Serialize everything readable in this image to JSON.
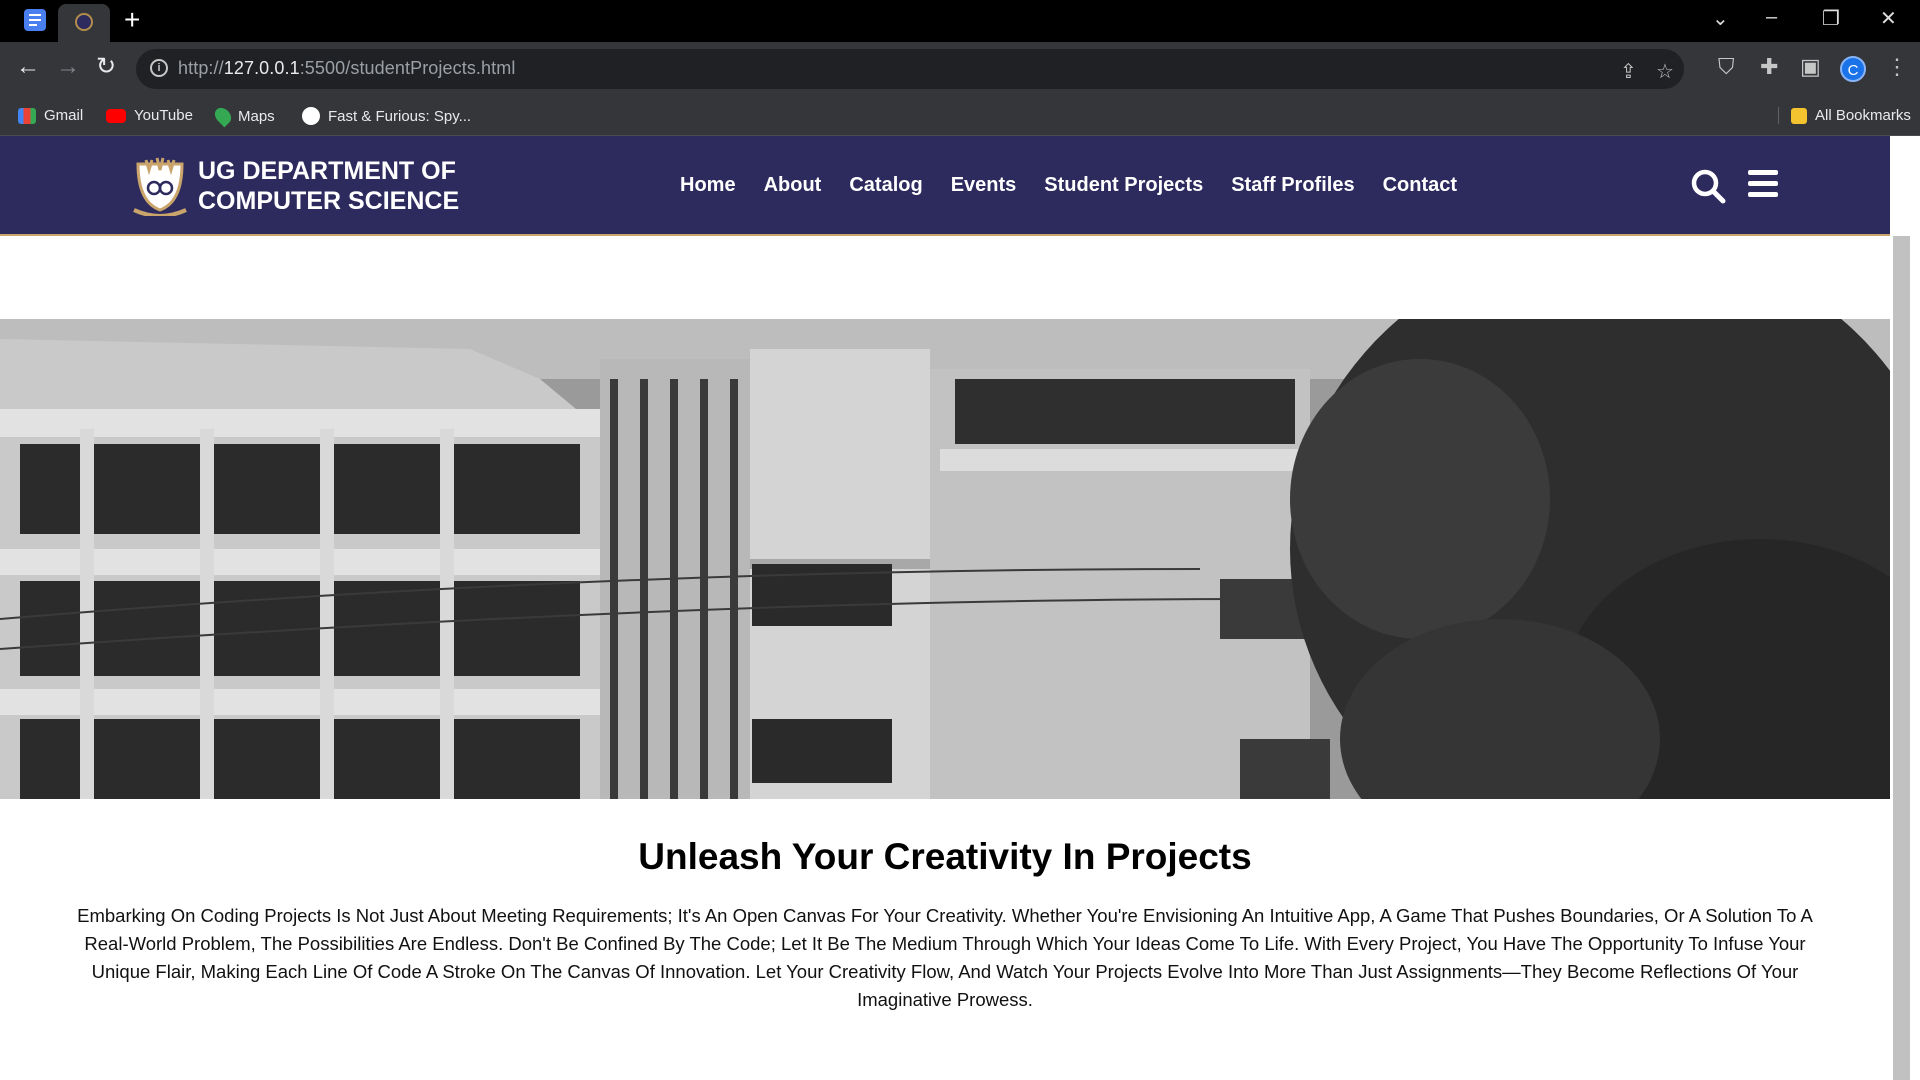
{
  "browser": {
    "url_prefix": "http://",
    "url_host": "127.0.0.1",
    "url_rest": ":5500/studentProjects.html",
    "new_tab_symbol": "+",
    "profile_initial": "C",
    "bookmarks": [
      "Gmail",
      "YouTube",
      "Maps",
      "Fast & Furious: Spy..."
    ],
    "all_bookmarks": "All Bookmarks"
  },
  "site": {
    "brand_line1": "UG DEPARTMENT OF",
    "brand_line2": "COMPUTER SCIENCE",
    "nav": [
      "Home",
      "About",
      "Catalog",
      "Events",
      "Student Projects",
      "Staff Profiles",
      "Contact"
    ],
    "header_color": "#2d2a5e",
    "accent_color": "#c9a46b"
  },
  "main": {
    "heading": "Unleash Your Creativity In Projects",
    "paragraph": "Embarking On Coding Projects Is Not Just About Meeting Requirements; It's An Open Canvas For Your Creativity. Whether You're Envisioning An Intuitive App, A Game That Pushes Boundaries, Or A Solution To A Real-World Problem, The Possibilities Are Endless. Don't Be Confined By The Code; Let It Be The Medium Through Which Your Ideas Come To Life. With Every Project, You Have The Opportunity To Infuse Your Unique Flair, Making Each Line Of Code A Stroke On The Canvas Of Innovation. Let Your Creativity Flow, And Watch Your Projects Evolve Into More Than Just Assignments—They Become Reflections Of Your Imaginative Prowess."
  },
  "icons": [
    "docs-icon",
    "university-logo-icon",
    "info-icon",
    "share-icon",
    "star-icon",
    "shield-icon",
    "puzzle-icon",
    "sidepanel-icon",
    "search-icon",
    "hamburger-menu-icon"
  ]
}
